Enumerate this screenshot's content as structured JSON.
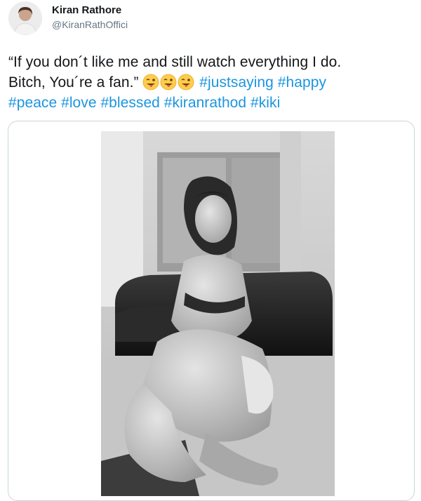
{
  "user": {
    "display_name": "Kiran Rathore",
    "handle": "@KiranRathOffici",
    "avatar_icon": "profile-avatar"
  },
  "tweet": {
    "line1": "“If you don´t like me and still watch everything I do.",
    "line2_text": "Bitch, You´re a fan.”",
    "emojis": [
      "winking-tongue-face",
      "winking-tongue-face",
      "winking-tongue-face"
    ],
    "hashtags": [
      "#justsaying",
      "#happy",
      "#peace",
      "#love",
      "#blessed",
      "#kiranrathod",
      "#kiki"
    ]
  },
  "media": {
    "type": "photo",
    "description_icon": "black-and-white-photo"
  },
  "colors": {
    "hashtag": "#1b95e0",
    "text": "#14171a",
    "secondary": "#657786",
    "border": "#ccd6dd"
  }
}
